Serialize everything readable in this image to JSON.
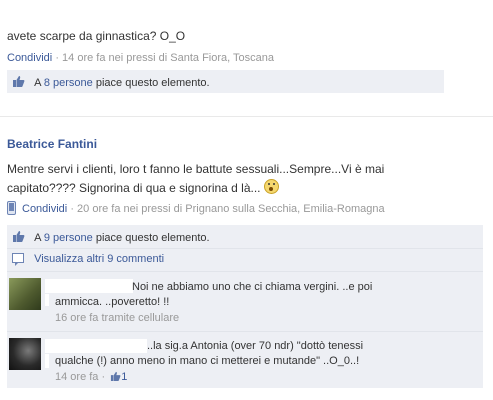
{
  "post1": {
    "message": "avete scarpe da ginnastica? O_O",
    "share_label": "Condividi",
    "time": "14 ore fa nei pressi di Santa Fiora, Toscana",
    "likes": {
      "prefix": "A",
      "count_link": "8 persone",
      "suffix": "piace questo elemento."
    }
  },
  "post2": {
    "author": "Beatrice Fantini",
    "message_line1": "Mentre servi i clienti, loro t fanno le battute sessuali...Sempre...Vi è mai",
    "message_line2": "capitato???? Signorina di qua e signorina d là...",
    "emoticon": "😮",
    "share_label": "Condividi",
    "time": "20 ore fa nei pressi di Prignano sulla Secchia, Emilia-Romagna",
    "likes": {
      "prefix": "A",
      "count_link": "9 persone",
      "suffix": "piace questo elemento."
    },
    "view_comments": "Visualizza altri 9 commenti",
    "comments": [
      {
        "line1": "Noi ne abbiamo uno che ci chiama vergini. ..e poi",
        "line2": "ammicca. ..poveretto! !!",
        "meta": "16 ore fa tramite cellulare"
      },
      {
        "line1": "..la sig.a Antonia (over 70 ndr) \"dottò tenessi",
        "line2": "qualche (!) anno meno in mano ci metterei e mutande\" ..O_0..!",
        "meta": "14 ore fa ·",
        "like_count": "1"
      }
    ]
  },
  "colors": {
    "link": "#3b5998",
    "meta": "#999999",
    "box": "#edeff4"
  }
}
